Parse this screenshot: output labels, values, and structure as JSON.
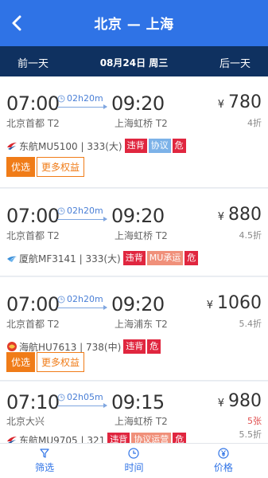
{
  "header": {
    "title": "北京 — 上海"
  },
  "datebar": {
    "prev": "前一天",
    "current": "08月24日 周三",
    "next": "后一天"
  },
  "flights": [
    {
      "dep_time": "07:00",
      "duration": "02h20m",
      "arr_time": "09:20",
      "dep_airport": "北京首都 T2",
      "arr_airport": "上海虹桥 T2",
      "price": "780",
      "discount": "4折",
      "airline_code": "东航MU5100 | 333(大)",
      "logo": "china-eastern-logo",
      "tags": [
        {
          "text": "违背",
          "color": "red"
        },
        {
          "text": "协议",
          "color": "blue"
        },
        {
          "text": "危",
          "color": "red"
        }
      ],
      "actions": {
        "primary": "优选",
        "secondary": "更多权益"
      }
    },
    {
      "dep_time": "07:00",
      "duration": "02h20m",
      "arr_time": "09:20",
      "dep_airport": "北京首都 T2",
      "arr_airport": "上海虹桥 T2",
      "price": "880",
      "discount": "4.5折",
      "airline_code": "厦航MF3141 | 333(大)",
      "logo": "xiamen-airlines-logo",
      "tags": [
        {
          "text": "违背",
          "color": "red"
        },
        {
          "text": "MU承运",
          "color": "pink"
        },
        {
          "text": "危",
          "color": "red"
        }
      ]
    },
    {
      "dep_time": "07:00",
      "duration": "02h20m",
      "arr_time": "09:20",
      "dep_airport": "北京首都 T2",
      "arr_airport": "上海浦东 T2",
      "price": "1060",
      "discount": "5.4折",
      "airline_code": "海航HU7613 | 738(中)",
      "logo": "hainan-airlines-logo",
      "tags": [
        {
          "text": "违背",
          "color": "red"
        },
        {
          "text": "危",
          "color": "red"
        }
      ],
      "actions": {
        "primary": "优选",
        "secondary": "更多权益"
      }
    },
    {
      "dep_time": "07:10",
      "duration": "02h05m",
      "arr_time": "09:15",
      "dep_airport": "北京大兴",
      "arr_airport": "上海虹桥 T2",
      "price": "980",
      "discount": "5.5折",
      "seats": "5张",
      "airline_code": "东航MU9705 | 321",
      "logo": "china-eastern-logo",
      "tags": [
        {
          "text": "违背",
          "color": "red"
        },
        {
          "text": "协议运营",
          "color": "pink"
        },
        {
          "text": "危",
          "color": "red"
        }
      ]
    }
  ],
  "currency_symbol": "¥",
  "tabbar": {
    "filter": "筛选",
    "time": "时间",
    "price": "价格"
  },
  "colors": {
    "primary": "#2f73e6",
    "date_bar": "#0f3160",
    "accent_orange": "#f07c18",
    "tag_red": "#e0263f"
  }
}
